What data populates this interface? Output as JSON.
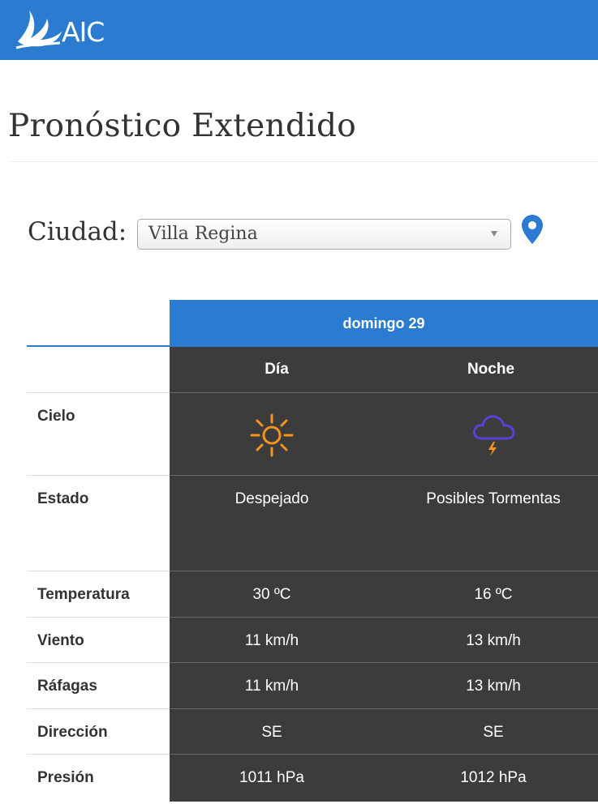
{
  "header": {
    "logo_text": "AIC",
    "brand_color": "#2b7bd1"
  },
  "page": {
    "title": "Pronóstico Extendido"
  },
  "city": {
    "label": "Ciudad:",
    "selected": "Villa Regina",
    "location_icon": "map-pin-icon"
  },
  "forecast": {
    "date": "domingo 29",
    "columns": [
      "Día",
      "Noche"
    ],
    "rows": {
      "cielo": {
        "label": "Cielo",
        "day_icon": "sun-icon",
        "night_icon": "storm-cloud-icon"
      },
      "estado": {
        "label": "Estado",
        "day": "Despejado",
        "night": "Posibles Tormentas"
      },
      "temperatura": {
        "label": "Temperatura",
        "day": "30 ºC",
        "night": "16 ºC"
      },
      "viento": {
        "label": "Viento",
        "day": "11 km/h",
        "night": "13 km/h"
      },
      "rafagas": {
        "label": "Ráfagas",
        "day": "11 km/h",
        "night": "13 km/h"
      },
      "direccion": {
        "label": "Dirección",
        "day": "SE",
        "night": "SE"
      },
      "presion": {
        "label": "Presión",
        "day": "1011 hPa",
        "night": "1012 hPa"
      }
    },
    "colors": {
      "table_dark": "#3c3c3c",
      "sun": "#f7941d",
      "storm_cloud": "#5b3fd6"
    }
  }
}
